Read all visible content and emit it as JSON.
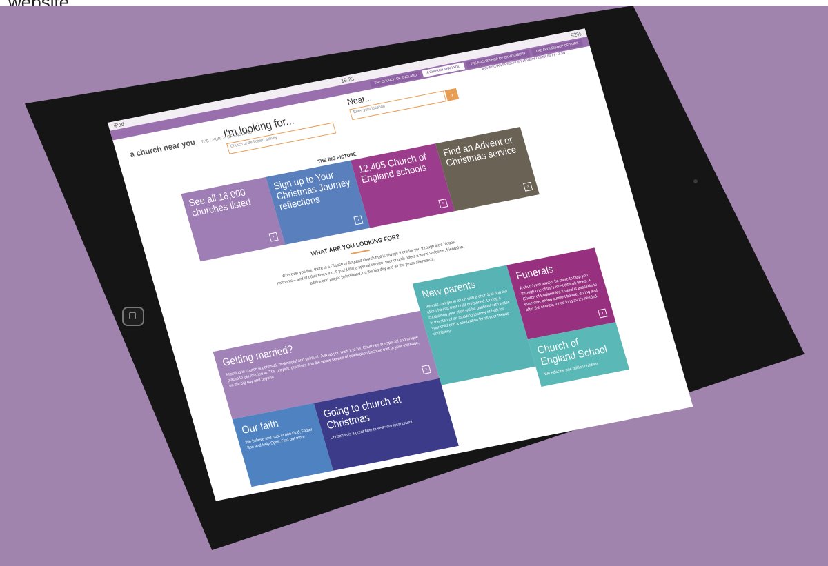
{
  "caption": "website",
  "device": {
    "status_left": "iPad",
    "status_time": "19:23",
    "status_right": "92%"
  },
  "site": {
    "nav": [
      "THE CHURCH OF ENGLAND",
      "A CHURCH NEAR YOU",
      "THE ARCHBISHOP OF CANTERBURY",
      "THE ARCHBISHOP OF YORK"
    ],
    "subnav": "A CHRISTIAN PRESENCE IN EVERY COMMUNITY - JOIN",
    "logo": "a church near you",
    "logo_sub": "THE CHURCH OF ENGLAND",
    "search": {
      "looking_for_label": "I'm looking for...",
      "looking_for_placeholder": "Church or dedicated activity",
      "near_label": "Near...",
      "near_placeholder": "Enter your location",
      "go_label": "Go"
    },
    "big_picture_heading": "THE BIG PICTURE",
    "tiles": [
      {
        "label": "See all 16,000 churches listed",
        "color": "#9f7db5"
      },
      {
        "label": "Sign up to Your Christmas Journey reflections",
        "color": "#5a7fbd"
      },
      {
        "label": "12,405 Church of England schools",
        "color": "#9c3c8c"
      },
      {
        "label": "Find an Advent or Christmas service",
        "color": "#6b6256"
      }
    ],
    "what_heading": "WHAT ARE YOU LOOKING FOR?",
    "intro": "Wherever you live, there is a Church of England church that is always there for you through life's biggest moments – and at other times too. If you'd like a special service, your church offers a warm welcome, friendship, advice and prayer beforehand, on the big day and all the years afterwards.",
    "cards": [
      {
        "title": "Getting married?",
        "text": "Marrying in church is personal, meaningful and spiritual. Just as you want it to be. Churches are special and unique places to get married in. The prayers, promises and the whole service of celebration become part of your marriage, on the big day and beyond.",
        "color": "#a283b8"
      },
      {
        "title": "New parents",
        "text": "Parents can get in touch with a church to find out about having their child christened. During a christening your child will be baptised with water, in the start of an amazing journey of faith for your child and a celebration for all your friends and family.",
        "color": "#58b3b5"
      },
      {
        "title": "Funerals",
        "text": "A church will always be there to help you through one of life's most difficult times. A Church of England-led funeral is available to everyone, giving support before, during and after the service, for as long as it's needed.",
        "color": "#96307f"
      },
      {
        "title": "Church of England School",
        "text": "We educate one million children",
        "color": "#5ab8b6"
      },
      {
        "title": "Our faith",
        "text": "We believe and trust in one God, Father, Son and Holy Spirit. Find out more",
        "color": "#4f82c0"
      },
      {
        "title": "Going to church at Christmas",
        "text": "Christmas is a great time to visit your local church",
        "color": "#3b3b8a"
      }
    ]
  }
}
